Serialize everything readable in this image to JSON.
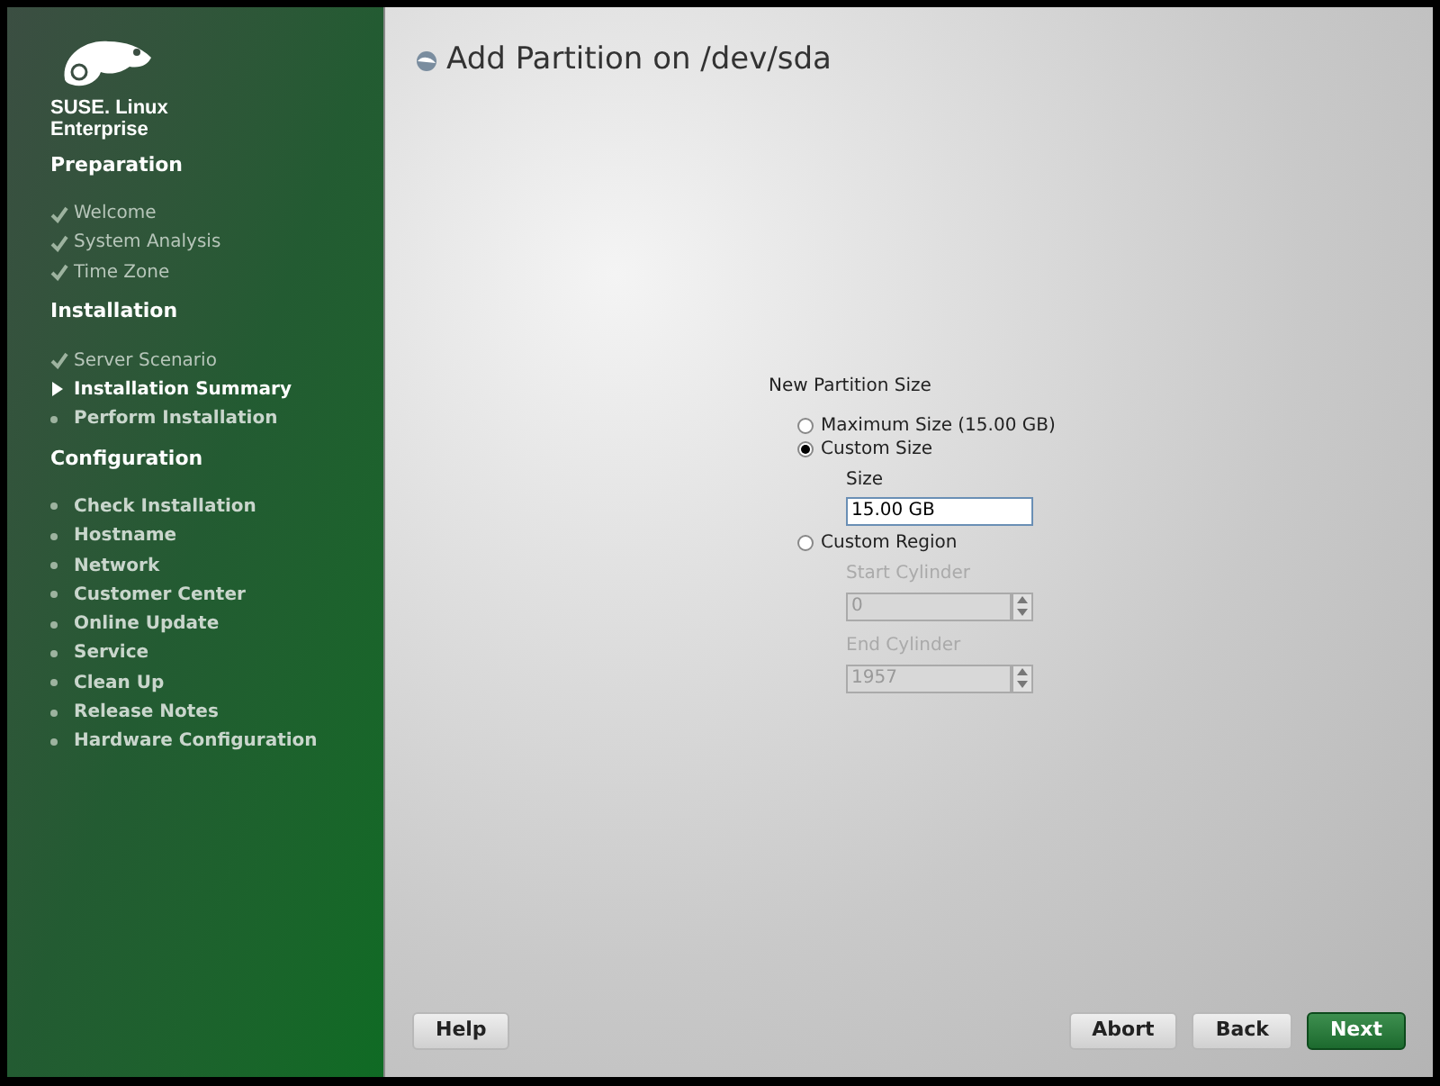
{
  "sidebar": {
    "brand": "SUSE. Linux Enterprise",
    "sections": [
      {
        "title": "Preparation",
        "steps": [
          {
            "label": "Welcome",
            "kind": "done"
          },
          {
            "label": "System Analysis",
            "kind": "done"
          },
          {
            "label": "Time Zone",
            "kind": "done"
          }
        ]
      },
      {
        "title": "Installation",
        "steps": [
          {
            "label": "Server Scenario",
            "kind": "done"
          },
          {
            "label": "Installation Summary",
            "kind": "current"
          },
          {
            "label": "Perform Installation",
            "kind": "pending"
          }
        ]
      },
      {
        "title": "Configuration",
        "steps": [
          {
            "label": "Check Installation",
            "kind": "pending"
          },
          {
            "label": "Hostname",
            "kind": "pending"
          },
          {
            "label": "Network",
            "kind": "pending"
          },
          {
            "label": "Customer Center",
            "kind": "pending"
          },
          {
            "label": "Online Update",
            "kind": "pending"
          },
          {
            "label": "Service",
            "kind": "pending"
          },
          {
            "label": "Clean Up",
            "kind": "pending"
          },
          {
            "label": "Release Notes",
            "kind": "pending"
          },
          {
            "label": "Hardware Configuration",
            "kind": "pending"
          }
        ]
      }
    ]
  },
  "dialog": {
    "title": "Add Partition on /dev/sda",
    "group_label": "New Partition Size",
    "options": [
      {
        "label": "Maximum Size (15.00 GB)",
        "selected": false
      },
      {
        "label": "Custom Size",
        "selected": true,
        "fields": [
          {
            "label": "Size",
            "value": "15.00 GB",
            "kind": "text",
            "disabled": false
          }
        ]
      },
      {
        "label": "Custom Region",
        "selected": false,
        "fields": [
          {
            "label": "Start Cylinder",
            "value": "0",
            "kind": "spin",
            "disabled": true
          },
          {
            "label": "End Cylinder",
            "value": "1957",
            "kind": "spin",
            "disabled": true
          }
        ]
      }
    ]
  },
  "buttons": {
    "left": [
      {
        "label": "Help",
        "primary": false
      }
    ],
    "right": [
      {
        "label": "Abort",
        "primary": false
      },
      {
        "label": "Back",
        "primary": false
      },
      {
        "label": "Next",
        "primary": true
      }
    ]
  }
}
